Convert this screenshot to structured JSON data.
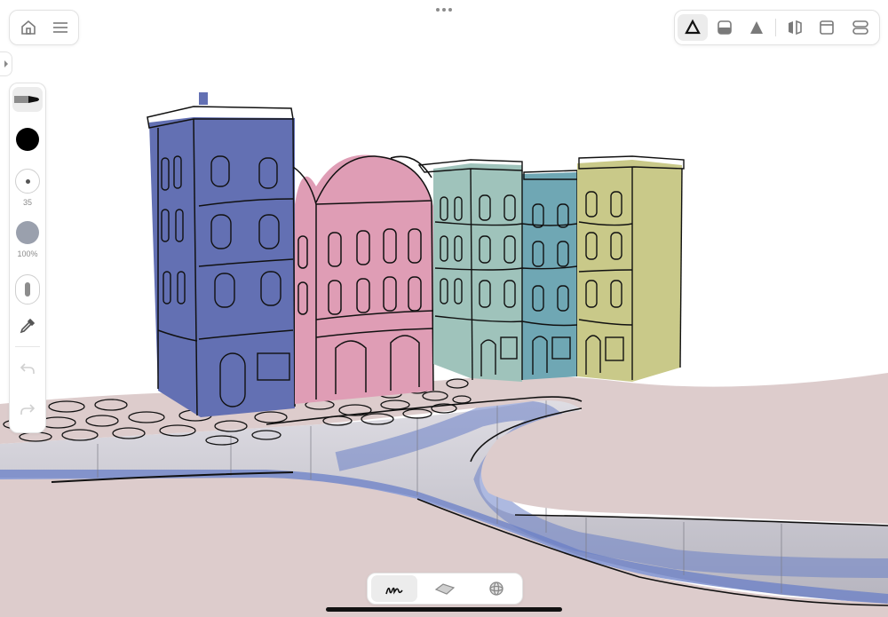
{
  "app": {
    "more_menu_icon": "ellipsis-icon",
    "top_left": {
      "home_icon": "home-icon",
      "menu_icon": "hamburger-menu-icon"
    },
    "sidebar_toggle_icon": "chevron-right-icon",
    "top_toolbar": {
      "tools": [
        {
          "name": "draw-tool",
          "icon": "triangle-outline-icon",
          "selected": true
        },
        {
          "name": "surface-tool",
          "icon": "rounded-square-half-icon",
          "selected": false
        },
        {
          "name": "solid-tool",
          "icon": "triangle-filled-icon",
          "selected": false
        },
        {
          "name": "mirror-tool",
          "icon": "mirror-icon",
          "selected": false
        },
        {
          "name": "frame-tool",
          "icon": "window-frame-icon",
          "selected": false
        },
        {
          "name": "layers-tool",
          "icon": "stacked-pills-icon",
          "selected": false
        }
      ]
    },
    "brush_panel": {
      "brush_icon": "marker-brush-icon",
      "color": "#000000",
      "size_value": "35",
      "opacity_color": "#9aa0ad",
      "opacity_value": "100%",
      "pressure_icon": "pill-slider-icon",
      "eyedropper_icon": "eyedropper-icon",
      "undo_icon": "undo-icon",
      "redo_icon": "redo-icon"
    },
    "bottom_toolbar": {
      "tools": [
        {
          "name": "stroke-mode",
          "icon": "handwriting-icon",
          "selected": true
        },
        {
          "name": "plane-mode",
          "icon": "plane-icon",
          "selected": false
        },
        {
          "name": "sphere-mode",
          "icon": "sphere-icon",
          "selected": false
        }
      ]
    },
    "colors": {
      "blue_building": "#6370b3",
      "pink_building": "#df9db5",
      "teal_building": "#9fc3bb",
      "teal2_building": "#6fa7b4",
      "yellow_building": "#c9c989",
      "ground": "#ddcccc",
      "water": "#6a7fc7"
    }
  }
}
